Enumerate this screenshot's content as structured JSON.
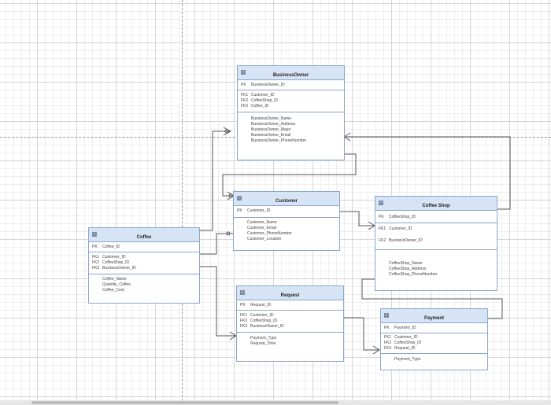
{
  "entities": {
    "business_owner": {
      "title": "BusinessOwner",
      "pk": {
        "key": "PK",
        "field": "BusinessOwner_ID"
      },
      "fks": [
        {
          "key": "FK1",
          "field": "Customer_ID"
        },
        {
          "key": "FK2",
          "field": "CoffeeShop_ID"
        },
        {
          "key": "FK2",
          "field": "Coffee_ID"
        }
      ],
      "attrs": [
        "BusinessOwner_Name",
        "BusinessOwner_Address",
        "BusinessOwner_Major",
        "BusinessOwner_Email",
        "BusinessOwner_PhoneNumber"
      ]
    },
    "customer": {
      "title": "Customer",
      "pk": {
        "key": "PK",
        "field": "Customer_ID"
      },
      "fks": [],
      "attrs": [
        "Customer_Name",
        "Customer_Email",
        "Customer_PhoneNumber",
        "Customer_Location"
      ]
    },
    "coffee_shop": {
      "title": "Coffee Shop",
      "pk": {
        "key": "PK",
        "field": "CoffeeShop_ID"
      },
      "fks": [
        {
          "key": "FK1",
          "field": "Customer_ID"
        },
        {
          "key": "FK2",
          "field": "BusinessOwner_ID"
        }
      ],
      "attrs": [
        "CoffeeShop_Name",
        "CoffeeShop_Address",
        "CoffeeShop_PhoneNumber"
      ]
    },
    "coffee": {
      "title": "Coffee",
      "pk": {
        "key": "PK",
        "field": "Coffee_ID"
      },
      "fks": [
        {
          "key": "FK1",
          "field": "Customer_ID"
        },
        {
          "key": "FK2",
          "field": "CoffeeShop_ID"
        },
        {
          "key": "FK2",
          "field": "BusinessOwner_ID"
        }
      ],
      "attrs": [
        "Coffee_Name",
        "Quantity_Coffee",
        "Coffee_Cost"
      ]
    },
    "request": {
      "title": "Request",
      "pk": {
        "key": "PK",
        "field": "Request_ID"
      },
      "fks": [
        {
          "key": "FK1",
          "field": "Customer_ID"
        },
        {
          "key": "FK2",
          "field": "CoffeeShop_ID"
        },
        {
          "key": "FK3",
          "field": "BusinessOwner_ID"
        }
      ],
      "attrs": [
        "Payment_Type",
        "Request_Time"
      ]
    },
    "payment": {
      "title": "Payment",
      "pk": {
        "key": "PK",
        "field": "Payment_ID"
      },
      "fks": [
        {
          "key": "FK1",
          "field": "Customer_ID"
        },
        {
          "key": "FK2",
          "field": "CoffeeShop_ID"
        },
        {
          "key": "FK3",
          "field": "Request_ID"
        }
      ],
      "attrs": [
        "Payment_Type"
      ]
    }
  },
  "toggle_glyph": "−",
  "colors": {
    "header": "#d7e4f6",
    "border": "#8aa6cc",
    "connector": "#555555"
  }
}
